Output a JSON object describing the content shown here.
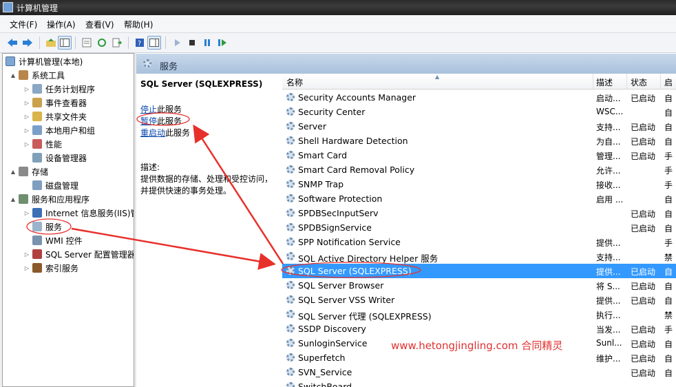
{
  "window": {
    "title": "计算机管理"
  },
  "menu": [
    "文件(F)",
    "操作(A)",
    "查看(V)",
    "帮助(H)"
  ],
  "tree": {
    "root": "计算机管理(本地)",
    "items": [
      {
        "label": "系统工具",
        "level": 1,
        "expand": "▲"
      },
      {
        "label": "任务计划程序",
        "level": 2,
        "expand": "▷"
      },
      {
        "label": "事件查看器",
        "level": 2,
        "expand": "▷"
      },
      {
        "label": "共享文件夹",
        "level": 2,
        "expand": "▷"
      },
      {
        "label": "本地用户和组",
        "level": 2,
        "expand": "▷"
      },
      {
        "label": "性能",
        "level": 2,
        "expand": "▷"
      },
      {
        "label": "设备管理器",
        "level": 2,
        "expand": ""
      },
      {
        "label": "存储",
        "level": 1,
        "expand": "▲"
      },
      {
        "label": "磁盘管理",
        "level": 2,
        "expand": ""
      },
      {
        "label": "服务和应用程序",
        "level": 1,
        "expand": "▲"
      },
      {
        "label": "Internet 信息服务(IIS)管",
        "level": 2,
        "expand": "▷"
      },
      {
        "label": "服务",
        "level": 2,
        "expand": ""
      },
      {
        "label": "WMI 控件",
        "level": 2,
        "expand": ""
      },
      {
        "label": "SQL Server 配置管理器",
        "level": 2,
        "expand": "▷"
      },
      {
        "label": "索引服务",
        "level": 2,
        "expand": "▷"
      }
    ]
  },
  "panel": {
    "title": "服务"
  },
  "extended": {
    "service_name": "SQL Server (SQLEXPRESS)",
    "actions": [
      {
        "link": "停止",
        "rest": "此服务"
      },
      {
        "link": "暂停",
        "rest": "此服务"
      },
      {
        "link": "重启动",
        "rest": "此服务"
      }
    ],
    "desc_label": "描述:",
    "desc_text": "提供数据的存储、处理和受控访问，并提供快速的事务处理。"
  },
  "list": {
    "columns": [
      "名称",
      "描述",
      "状态",
      "启"
    ],
    "rows": [
      [
        "Security Accounts Manager",
        "启动...",
        "已启动",
        "自"
      ],
      [
        "Security Center",
        "WSC...",
        "",
        "自"
      ],
      [
        "Server",
        "支持...",
        "已启动",
        "自"
      ],
      [
        "Shell Hardware Detection",
        "为自...",
        "已启动",
        "自"
      ],
      [
        "Smart Card",
        "管理...",
        "已启动",
        "手"
      ],
      [
        "Smart Card Removal Policy",
        "允许...",
        "",
        "手"
      ],
      [
        "SNMP Trap",
        "接收...",
        "",
        "手"
      ],
      [
        "Software Protection",
        "启用 ...",
        "",
        "自"
      ],
      [
        "SPDBSecInputServ",
        "",
        "已启动",
        "自"
      ],
      [
        "SPDBSignService",
        "",
        "已启动",
        "自"
      ],
      [
        "SPP Notification Service",
        "提供...",
        "",
        "手"
      ],
      [
        "SQL Active Directory Helper 服务",
        "支持...",
        "",
        "禁"
      ],
      [
        "SQL Server (SQLEXPRESS)",
        "提供...",
        "已启动",
        "自"
      ],
      [
        "SQL Server Browser",
        "将 S...",
        "已启动",
        "自"
      ],
      [
        "SQL Server VSS Writer",
        "提供...",
        "已启动",
        "自"
      ],
      [
        "SQL Server 代理 (SQLEXPRESS)",
        "执行...",
        "",
        "禁"
      ],
      [
        "SSDP Discovery",
        "当发...",
        "已启动",
        "手"
      ],
      [
        "SunloginService",
        "Sunl...",
        "已启动",
        "自"
      ],
      [
        "Superfetch",
        "维护...",
        "已启动",
        "自"
      ],
      [
        "SVN_Service",
        "",
        "已启动",
        "自"
      ],
      [
        "SwitchBoard",
        "",
        "",
        ""
      ]
    ],
    "selected_index": 12
  },
  "watermark": "www.hetongjingling.com 合同精灵",
  "colors": {
    "selection": "#3399ff",
    "annotation": "#e8302b",
    "link": "#0645ad"
  }
}
